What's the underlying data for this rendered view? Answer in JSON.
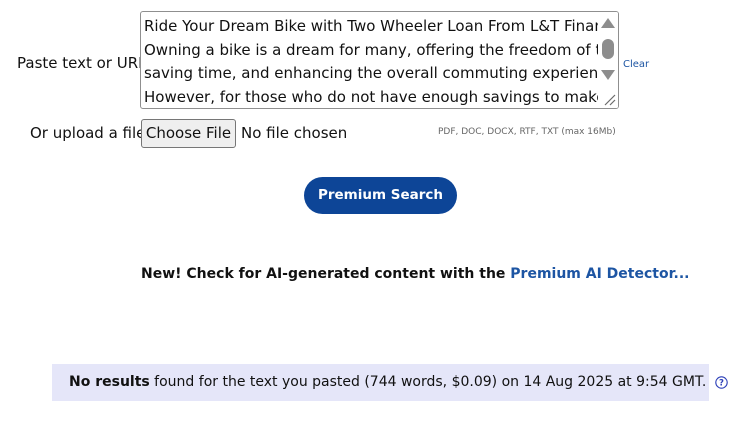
{
  "form": {
    "paste_label": "Paste text or URL:",
    "text_lines": [
      "Ride Your Dream Bike with Two Wheeler Loan From L&T Finance",
      "Owning a bike is a dream for many, offering the freedom of travel,",
      "saving time, and enhancing the overall commuting experience.",
      "However, for those who do not have enough savings to make a"
    ],
    "clear_label": "Clear",
    "upload_label": "Or upload a file:",
    "choose_file_label": "Choose File",
    "file_status": "No file chosen",
    "file_types": "PDF, DOC, DOCX, RTF, TXT (max 16Mb)"
  },
  "search_button_label": "Premium Search",
  "ai_notice": {
    "text": "New! Check for AI-generated content with the ",
    "link": "Premium AI Detector..."
  },
  "result": {
    "bold": "No results",
    "rest": " found for the text you pasted (744 words, $0.09) on 14 Aug 2025 at 9:54 GMT."
  },
  "icons": {
    "scroll_up": "triangle-up-icon",
    "scroll_down": "triangle-down-icon",
    "resize": "resize-grip-icon",
    "help": "question-circle-icon"
  },
  "colors": {
    "brand_blue": "#0d4597",
    "link_blue": "#1d55a3",
    "result_bg": "#e5e6f9"
  }
}
